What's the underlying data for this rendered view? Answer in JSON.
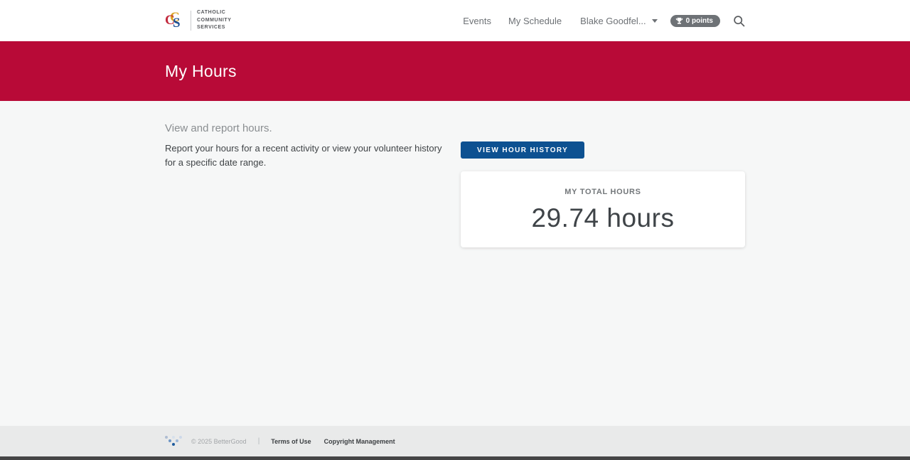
{
  "header": {
    "logo": {
      "monogram": [
        "C",
        "C",
        "S"
      ],
      "org_lines": [
        "CATHOLIC",
        "COMMUNITY",
        "SERVICES"
      ]
    },
    "nav": [
      {
        "label": "Events"
      },
      {
        "label": "My Schedule"
      }
    ],
    "user_menu": {
      "label": "Blake Goodfel..."
    },
    "points_badge": {
      "label": "0 points"
    }
  },
  "banner": {
    "title": "My Hours"
  },
  "main": {
    "heading": "View and report hours.",
    "description": "Report your hours for a recent activity or view your volunteer history for a specific date range.",
    "history_button": "VIEW HOUR HISTORY",
    "total_hours_card": {
      "label": "MY TOTAL HOURS",
      "value": "29.74 hours"
    }
  },
  "footer": {
    "copyright": "© 2025 BetterGood",
    "divider": "|",
    "links": [
      {
        "label": "Terms of Use"
      },
      {
        "label": "Copyright Management"
      }
    ]
  },
  "icons": {
    "brand": "ccs-monogram-icon",
    "user_menu": "chevron-down-icon",
    "points": "trophy-icon",
    "search": "search-icon",
    "footer_logo": "bettergood-dots-icon"
  },
  "colors": {
    "banner_red": "#b80a37",
    "button_blue": "#0d5191",
    "page_bg": "#f6f7f7",
    "footer_bg": "#e9eaea",
    "pill_gray": "#6e7276",
    "logo_gold": "#d9a11f",
    "logo_red": "#c2293d",
    "logo_blue": "#1d4f94"
  }
}
